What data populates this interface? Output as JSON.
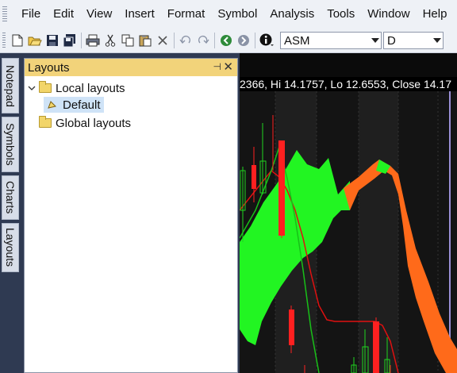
{
  "menu": [
    "File",
    "Edit",
    "View",
    "Insert",
    "Format",
    "Symbol",
    "Analysis",
    "Tools",
    "Window",
    "Help"
  ],
  "toolbar": {
    "buttons": [
      "new-icon",
      "open-icon",
      "save-icon",
      "save-all-icon",
      "print-icon",
      "cut-icon",
      "copy-icon",
      "paste-icon",
      "delete-icon",
      "undo-icon",
      "redo-icon",
      "back-icon",
      "forward-icon",
      "info-icon"
    ],
    "symbol_value": "ASM",
    "period_value": "D"
  },
  "side_tabs": [
    "Notepad",
    "Symbols",
    "Charts",
    "Layouts"
  ],
  "panel": {
    "title": "Layouts",
    "tree": {
      "local": "Local layouts",
      "default": "Default",
      "global": "Global layouts"
    }
  },
  "chart": {
    "info": "2366, Hi 14.1757, Lo 12.6553, Close 14.17"
  }
}
